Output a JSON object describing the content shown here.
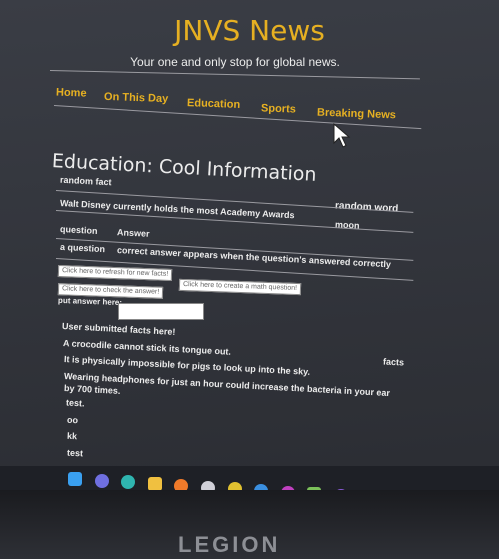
{
  "site": {
    "title": "JNVS News",
    "tagline": "Your one and only stop for global news."
  },
  "nav": {
    "items": [
      {
        "label": "Home"
      },
      {
        "label": "On This Day"
      },
      {
        "label": "Education"
      },
      {
        "label": "Sports"
      },
      {
        "label": "Breaking News"
      }
    ]
  },
  "page": {
    "heading": "Education: Cool Information"
  },
  "fact_section": {
    "fact_header": "random fact",
    "fact_value": "Walt Disney currently holds the most Academy Awards",
    "word_header": "random word",
    "word_value": "moon"
  },
  "qa_section": {
    "question_header": "question",
    "answer_header": "Answer",
    "question_value": "a question",
    "answer_value": "correct answer appears when the question's answered correctly"
  },
  "controls": {
    "refresh_button": "Click here to refresh for new facts!",
    "math_button": "Click here to create a math question!",
    "check_button": "Click here to check the answer!",
    "answer_label": "put answer here:",
    "answer_value": ""
  },
  "user_facts": {
    "heading": "User submitted facts here!",
    "side_label": "facts",
    "items": [
      "A crocodile cannot stick its tongue out.",
      "It is physically impossible for pigs to look up into the sky.",
      "Wearing headphones for just an hour could increase the bacteria in your ear",
      "by 700 times.",
      "test.",
      "oo",
      "kk",
      "test"
    ]
  },
  "taskbar": {
    "icons": [
      {
        "name": "windows-start-icon",
        "color": "#3aa0f0"
      },
      {
        "name": "teams-chat-icon",
        "color": "#6f6fe0"
      },
      {
        "name": "edge-browser-icon",
        "color": "#2fb5b0"
      },
      {
        "name": "file-explorer-icon",
        "color": "#f0c040"
      },
      {
        "name": "firefox-icon",
        "color": "#f07a2a"
      },
      {
        "name": "eclipse-icon",
        "color": "#d0d0d8"
      },
      {
        "name": "chrome-icon",
        "color": "#e0c030"
      },
      {
        "name": "chrome-canary-icon",
        "color": "#3a8fe0"
      },
      {
        "name": "firefox-dev-icon",
        "color": "#c040c0"
      },
      {
        "name": "notepad-plus-icon",
        "color": "#7bc05a"
      },
      {
        "name": "visual-studio-icon",
        "color": "#8a5ad8"
      },
      {
        "name": "vscode-icon",
        "color": "#2f8ee0"
      },
      {
        "name": "discord-icon",
        "color": "#5865f2"
      }
    ]
  },
  "device": {
    "brand": "LEGION"
  }
}
